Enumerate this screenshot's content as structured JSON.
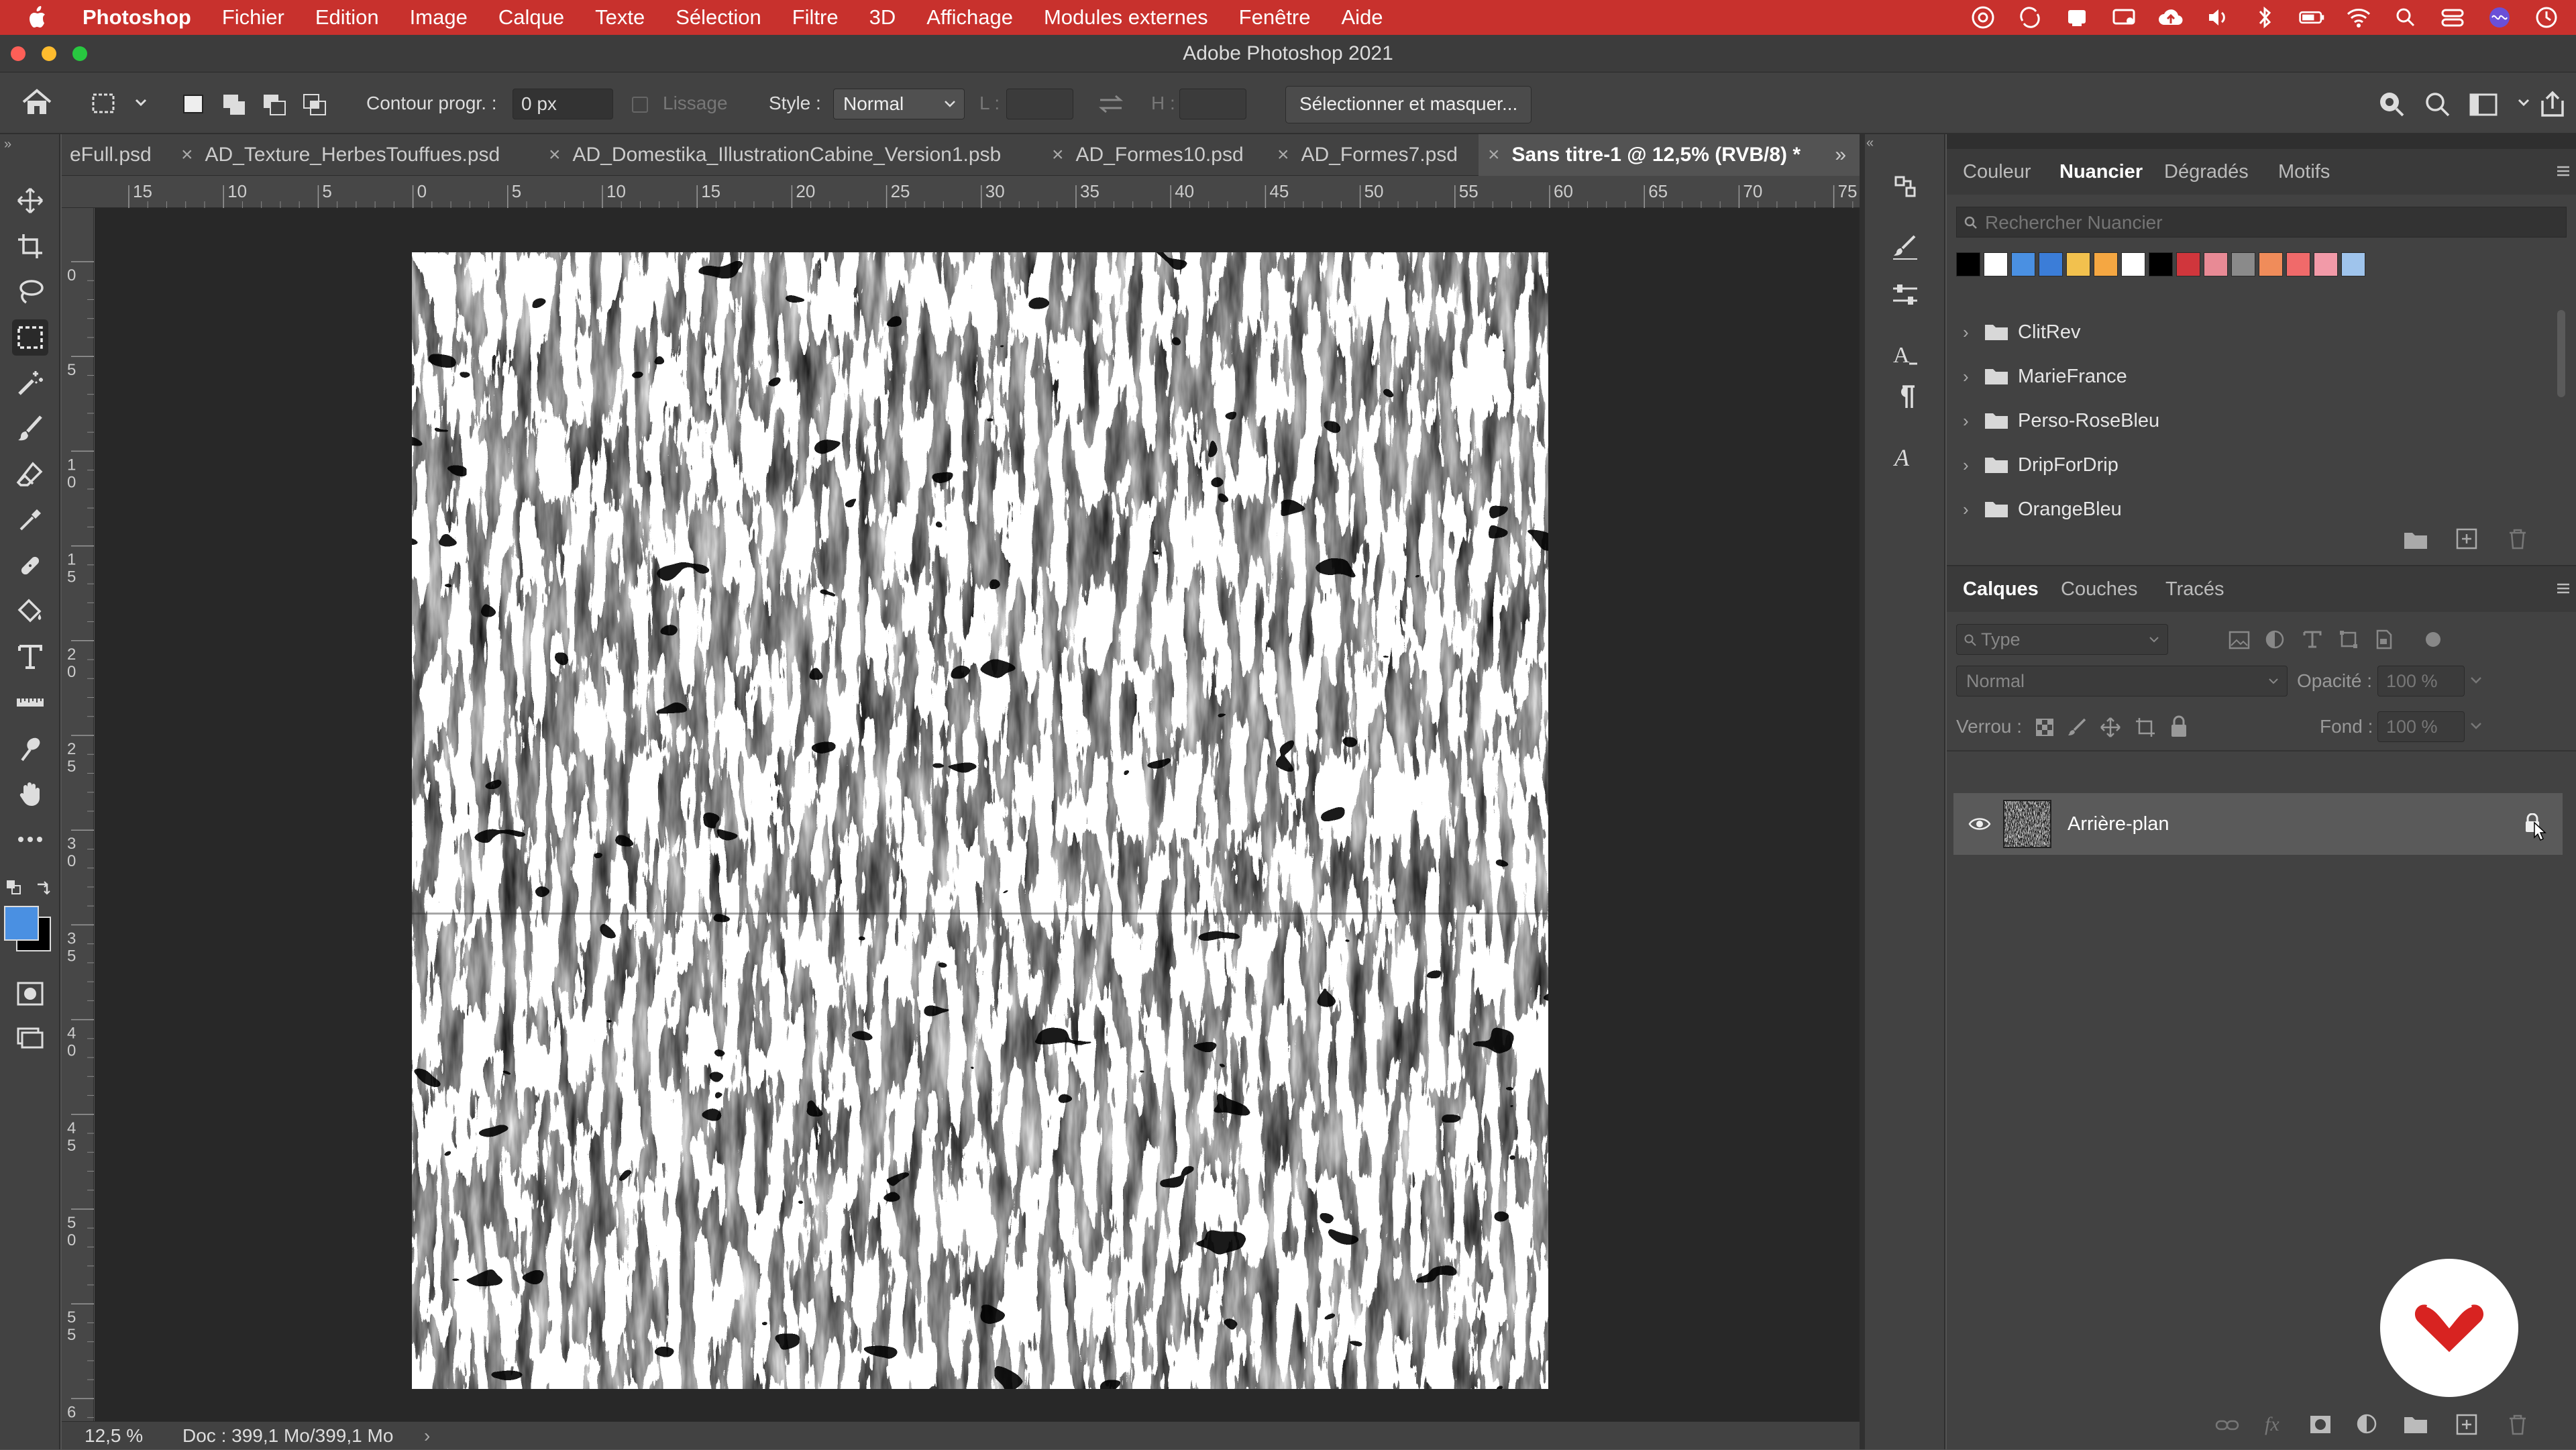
{
  "menubar": {
    "app": "Photoshop",
    "items": [
      "Fichier",
      "Edition",
      "Image",
      "Calque",
      "Texte",
      "Sélection",
      "Filtre",
      "3D",
      "Affichage",
      "Modules externes",
      "Fenêtre",
      "Aide"
    ]
  },
  "window": {
    "title": "Adobe Photoshop 2021"
  },
  "options_bar": {
    "feather_label": "Contour progr. :",
    "feather_value": "0 px",
    "antialias_label": "Lissage",
    "style_label": "Style :",
    "style_value": "Normal",
    "width_label": "L :",
    "height_label": "H :",
    "select_mask_button": "Sélectionner et masquer..."
  },
  "tabs": [
    {
      "label": "eFull.psd"
    },
    {
      "label": "AD_Texture_HerbesTouffues.psd"
    },
    {
      "label": "AD_Domestika_IllustrationCabine_Version1.psb"
    },
    {
      "label": "AD_Formes10.psd"
    },
    {
      "label": "AD_Formes7.psd"
    },
    {
      "label": "Sans titre-1 @ 12,5% (RVB/8) *"
    }
  ],
  "ruler": {
    "h_labels": [
      "15",
      "10",
      "5",
      "0",
      "5",
      "10",
      "15",
      "20",
      "25",
      "30",
      "35",
      "40",
      "45",
      "50",
      "55",
      "60",
      "65",
      "70",
      "75"
    ],
    "v_labels": [
      "0",
      "5",
      "10",
      "15",
      "20",
      "25",
      "30",
      "35",
      "40",
      "45",
      "50",
      "55",
      "60"
    ]
  },
  "status": {
    "zoom": "12,5 %",
    "doc": "Doc : 399,1 Mo/399,1 Mo"
  },
  "swatches_panel": {
    "tabs": [
      "Couleur",
      "Nuancier",
      "Dégradés",
      "Motifs"
    ],
    "active_tab": "Nuancier",
    "search_placeholder": "Rechercher Nuancier",
    "swatch_colors": [
      "#000000",
      "#ffffff",
      "#4a90e2",
      "#3b7dd8",
      "#f2c14e",
      "#f5a742",
      "#ffffff",
      "#000000",
      "#d0363c",
      "#e88a95",
      "#8a8a8a",
      "#f08c5a",
      "#f06a6a",
      "#f29aa8",
      "#9fc4ec"
    ],
    "groups": [
      "ClitRev",
      "MarieFrance",
      "Perso-RoseBleu",
      "DripForDrip",
      "OrangeBleu"
    ]
  },
  "layers_panel": {
    "tabs": [
      "Calques",
      "Couches",
      "Tracés"
    ],
    "active_tab": "Calques",
    "filter_placeholder": "Type",
    "blend_mode": "Normal",
    "opacity_label": "Opacité :",
    "opacity_value": "100 %",
    "lock_label": "Verrou :",
    "fill_label": "Fond :",
    "fill_value": "100 %",
    "layers": [
      {
        "name": "Arrière-plan",
        "visible": true,
        "locked": true
      }
    ]
  },
  "colors": {
    "menubar": "#c8312d",
    "foreground": "#4a90e2",
    "background": "#000000"
  }
}
